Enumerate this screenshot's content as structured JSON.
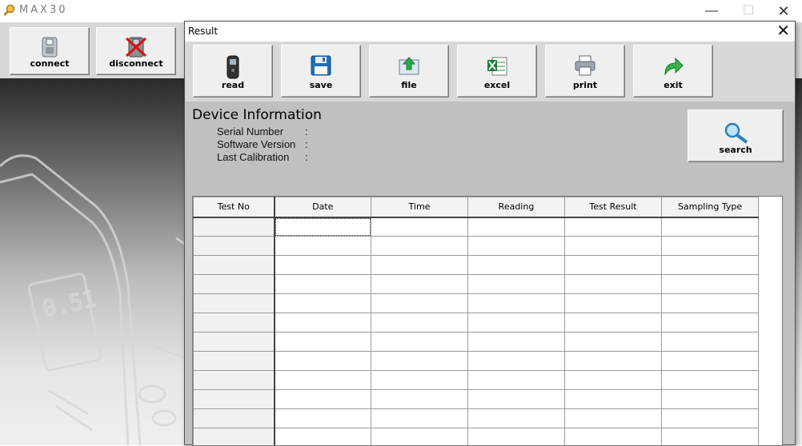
{
  "app": {
    "title": "MAX30",
    "window_controls": {
      "minimize": "—",
      "maximize": "☐",
      "close": "✕"
    },
    "toolbar": [
      {
        "label": "connect",
        "icon": "usb-icon"
      },
      {
        "label": "disconnect",
        "icon": "usb-disconnect-icon"
      }
    ]
  },
  "dialog": {
    "title": "Result",
    "close": "✕",
    "toolbar": [
      {
        "label": "read",
        "icon": "device-icon"
      },
      {
        "label": "save",
        "icon": "floppy-icon"
      },
      {
        "label": "file",
        "icon": "folder-open-icon"
      },
      {
        "label": "excel",
        "icon": "excel-icon"
      },
      {
        "label": "print",
        "icon": "printer-icon"
      },
      {
        "label": "exit",
        "icon": "exit-arrow-icon"
      }
    ],
    "device_info": {
      "heading": "Device Information",
      "fields": [
        {
          "label": "Serial Number",
          "sep": ":",
          "value": ""
        },
        {
          "label": "Software Version",
          "sep": ":",
          "value": ""
        },
        {
          "label": "Last Calibration",
          "sep": ":",
          "value": ""
        }
      ]
    },
    "search_label": "search",
    "grid": {
      "columns": [
        "Test No",
        "Date",
        "Time",
        "Reading",
        "Test Result",
        "Sampling Type"
      ],
      "rows": [
        [
          "",
          "",
          "",
          "",
          "",
          ""
        ],
        [
          "",
          "",
          "",
          "",
          "",
          ""
        ],
        [
          "",
          "",
          "",
          "",
          "",
          ""
        ],
        [
          "",
          "",
          "",
          "",
          "",
          ""
        ],
        [
          "",
          "",
          "",
          "",
          "",
          ""
        ],
        [
          "",
          "",
          "",
          "",
          "",
          ""
        ],
        [
          "",
          "",
          "",
          "",
          "",
          ""
        ],
        [
          "",
          "",
          "",
          "",
          "",
          ""
        ],
        [
          "",
          "",
          "",
          "",
          "",
          ""
        ],
        [
          "",
          "",
          "",
          "",
          "",
          ""
        ],
        [
          "",
          "",
          "",
          "",
          "",
          ""
        ],
        [
          "",
          "",
          "",
          "",
          "",
          ""
        ]
      ]
    }
  },
  "background_display": "0.51"
}
